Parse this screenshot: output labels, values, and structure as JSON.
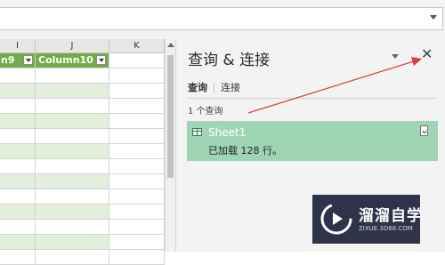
{
  "columns": {
    "i": "I",
    "j": "J",
    "k": "K",
    "header_col_i": "n9",
    "header_col_j": "Column10"
  },
  "queries_pane": {
    "title": "查询 & 连接",
    "tab_queries": "查询",
    "tab_connections": "连接",
    "query_count": "1 个查询",
    "query_name": "Sheet1",
    "query_status": "已加载 128 行。"
  },
  "watermark": {
    "brand": "溜溜自学",
    "url": "ZIXUE.3D66.COM"
  },
  "colors": {
    "header_green": "#70ad47",
    "band_green": "#e2efda",
    "card_green": "#9fd5b5",
    "arrow_red": "#e23b3b"
  }
}
